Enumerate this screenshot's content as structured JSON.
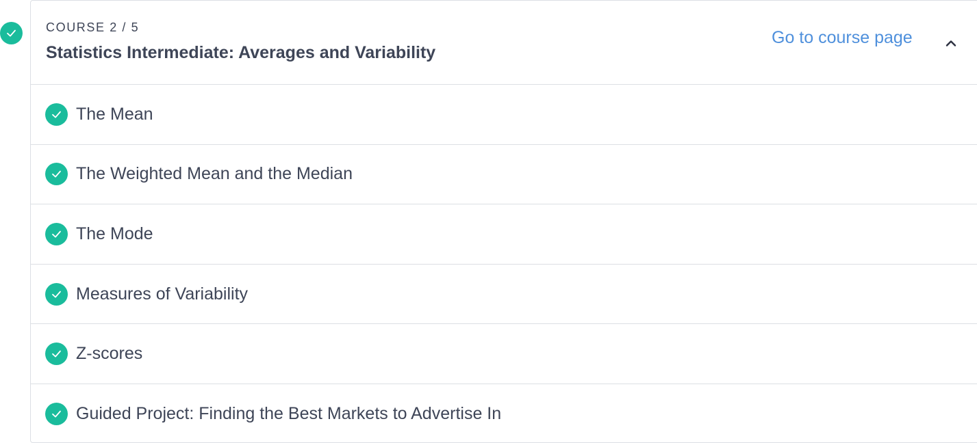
{
  "colors": {
    "accent": "#1abc9c",
    "link": "#4f90dc",
    "text": "#3e4557",
    "border": "#dcdfe4"
  },
  "course": {
    "status_icon": "check-icon",
    "kicker": "COURSE 2 / 5",
    "title": "Statistics Intermediate: Averages and Variability",
    "link_label": "Go to course page",
    "toggle_icon": "chevron-up-icon"
  },
  "lessons": [
    {
      "title": "The Mean",
      "status_icon": "check-icon"
    },
    {
      "title": "The Weighted Mean and the Median",
      "status_icon": "check-icon"
    },
    {
      "title": "The Mode",
      "status_icon": "check-icon"
    },
    {
      "title": "Measures of Variability",
      "status_icon": "check-icon"
    },
    {
      "title": "Z-scores",
      "status_icon": "check-icon"
    },
    {
      "title": "Guided Project: Finding the Best Markets to Advertise In",
      "status_icon": "check-icon"
    }
  ]
}
